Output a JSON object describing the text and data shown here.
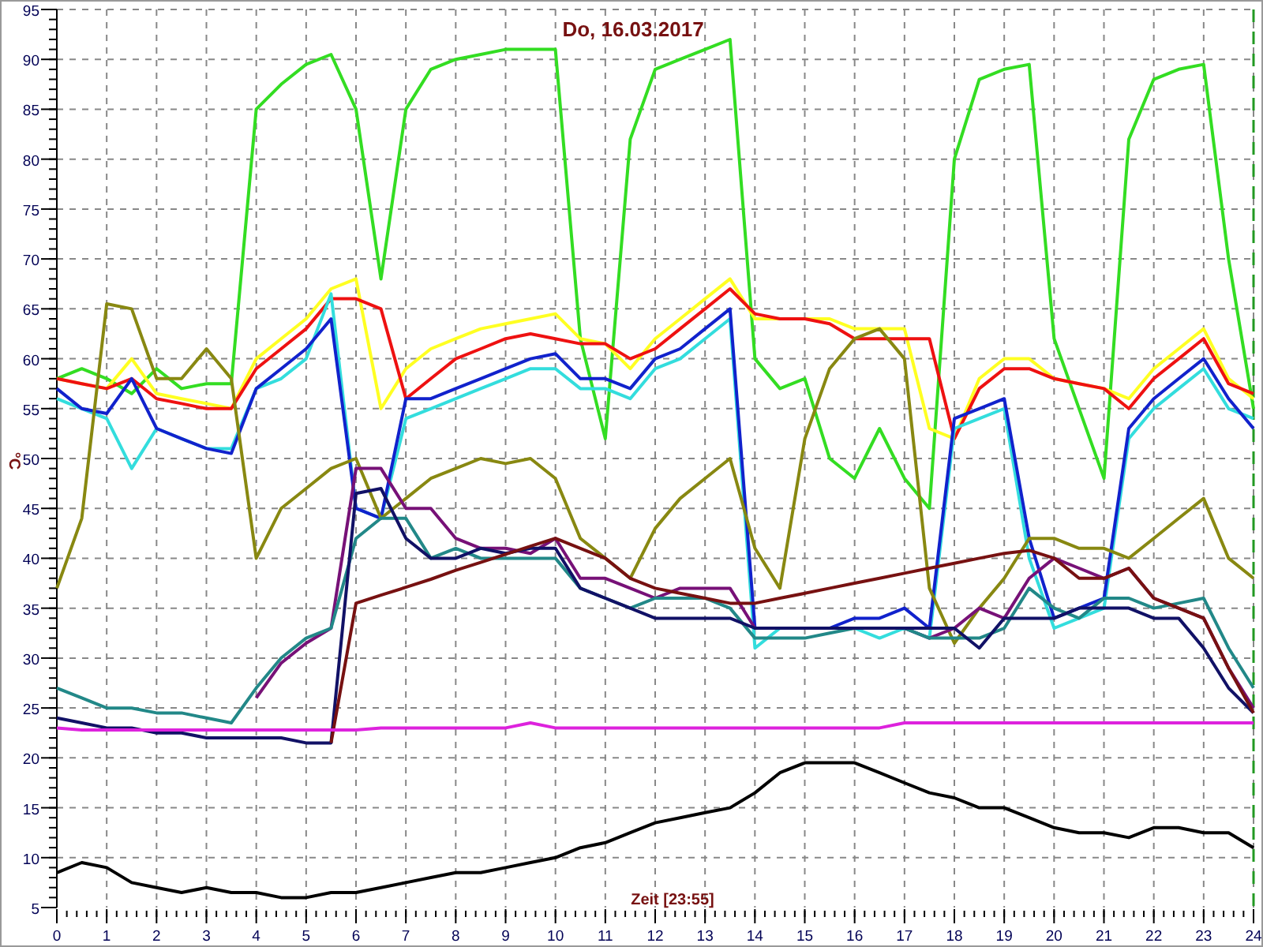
{
  "chart_data": {
    "type": "line",
    "title": "Do, 16.03.2017",
    "xlabel": "Zeit [23:55]",
    "ylabel": "°C",
    "x": [
      0,
      0.5,
      1,
      1.5,
      2,
      2.5,
      3,
      3.5,
      4,
      4.5,
      5,
      5.5,
      6,
      6.5,
      7,
      7.5,
      8,
      8.5,
      9,
      9.5,
      10,
      10.5,
      11,
      11.5,
      12,
      12.5,
      13,
      13.5,
      14,
      14.5,
      15,
      15.5,
      16,
      16.5,
      17,
      17.5,
      18,
      18.5,
      19,
      19.5,
      20,
      20.5,
      21,
      21.5,
      22,
      22.5,
      23,
      23.5,
      24
    ],
    "grid": true,
    "xlim": [
      0,
      24
    ],
    "ylim": [
      5,
      95
    ],
    "xticks": [
      0,
      1,
      2,
      3,
      4,
      5,
      6,
      7,
      8,
      9,
      10,
      11,
      12,
      13,
      14,
      15,
      16,
      17,
      18,
      19,
      20,
      21,
      22,
      23,
      24
    ],
    "yticks": [
      5,
      10,
      15,
      20,
      25,
      30,
      35,
      40,
      45,
      50,
      55,
      60,
      65,
      70,
      75,
      80,
      85,
      90,
      95
    ],
    "series": [
      {
        "color": "#33dd22",
        "values": [
          58,
          59,
          58,
          56.5,
          59,
          57,
          57.5,
          57.5,
          85,
          87.5,
          89.5,
          90.5,
          85,
          68,
          85,
          89,
          90,
          90.5,
          91,
          91,
          91,
          62,
          52,
          82,
          89,
          90,
          91,
          92,
          60,
          57,
          58,
          50,
          48,
          53,
          48,
          45,
          80,
          88,
          89,
          89.5,
          62,
          55,
          48,
          82,
          88,
          89,
          89.5,
          70,
          55
        ]
      },
      {
        "color": "#ffff22",
        "values": [
          58,
          57.5,
          57,
          60,
          56.5,
          56,
          55.5,
          55,
          60,
          62,
          64,
          67,
          68,
          55,
          59,
          61,
          62,
          63,
          63.5,
          64,
          64.5,
          62,
          61.5,
          59,
          62,
          64,
          66,
          68,
          64,
          64,
          64,
          64,
          63,
          63,
          63,
          53,
          52,
          58,
          60,
          60,
          58,
          57.5,
          57,
          56,
          59,
          61,
          63,
          58,
          56
        ]
      },
      {
        "color": "#ee1111",
        "values": [
          58,
          57.5,
          57,
          58,
          56,
          55.5,
          55,
          55,
          59,
          61,
          63,
          66,
          66,
          65,
          56,
          58,
          60,
          61,
          62,
          62.5,
          62,
          61.5,
          61.5,
          60,
          61,
          63,
          65,
          67,
          64.5,
          64,
          64,
          63.5,
          62,
          62,
          62,
          62,
          52,
          57,
          59,
          59,
          58,
          57.5,
          57,
          55,
          58,
          60,
          62,
          57.5,
          56.5
        ]
      },
      {
        "color": "#33dddd",
        "values": [
          56,
          55,
          54,
          49,
          53,
          52,
          51,
          51,
          57,
          58,
          60,
          66.5,
          45,
          44,
          54,
          55,
          56,
          57,
          58,
          59,
          59,
          57,
          57,
          56,
          59,
          60,
          62,
          64,
          31,
          33,
          33,
          33,
          33,
          32,
          33,
          32,
          53,
          54,
          55,
          40,
          33,
          34,
          35,
          52,
          55,
          57,
          59,
          55,
          54
        ]
      },
      {
        "color": "#1122cc",
        "values": [
          57,
          55,
          54.5,
          58,
          53,
          52,
          51,
          50.5,
          57,
          59,
          61,
          64,
          45,
          44,
          56,
          56,
          57,
          58,
          59,
          60,
          60.5,
          58,
          58,
          57,
          60,
          61,
          63,
          65,
          33,
          33,
          33,
          33,
          34,
          34,
          35,
          33,
          54,
          55,
          56,
          42,
          34,
          35,
          36,
          53,
          56,
          58,
          60,
          56,
          53
        ]
      },
      {
        "color": "#888811",
        "values": [
          37,
          44,
          65.5,
          65,
          58,
          58,
          61,
          58,
          40,
          45,
          47,
          49,
          50,
          44,
          46,
          48,
          49,
          50,
          49.5,
          50,
          48,
          42,
          40,
          38,
          43,
          46,
          48,
          50,
          41,
          37,
          52,
          59,
          62,
          63,
          60,
          37,
          31.5,
          35,
          38,
          42,
          42,
          41,
          41,
          40,
          42,
          44,
          46,
          40,
          38
        ]
      },
      {
        "color": "#771177",
        "values": [
          null,
          null,
          null,
          null,
          null,
          null,
          null,
          null,
          26,
          29.5,
          31.5,
          33,
          49,
          49,
          45,
          45,
          42,
          41,
          41,
          40.5,
          42,
          38,
          38,
          37,
          36,
          37,
          37,
          37,
          33,
          33,
          33,
          33,
          33,
          33,
          33,
          32,
          33,
          35,
          34,
          38,
          40,
          39,
          38,
          39,
          36,
          35,
          34,
          29,
          25
        ]
      },
      {
        "color": "#228888",
        "values": [
          27,
          26,
          25,
          25,
          24.5,
          24.5,
          24,
          23.5,
          27,
          30,
          32,
          33,
          42,
          44,
          44,
          40,
          41,
          40,
          40,
          40,
          40,
          37,
          36,
          35,
          36,
          36,
          36,
          35,
          32,
          32,
          32,
          32.5,
          33,
          33,
          33,
          32,
          32,
          32,
          33,
          37,
          35,
          34,
          36,
          36,
          35,
          35.5,
          36,
          31,
          27
        ]
      },
      {
        "color": "#111166",
        "values": [
          24,
          23.5,
          23,
          23,
          22.5,
          22.5,
          22,
          22,
          22,
          22,
          21.5,
          21.5,
          46.5,
          47,
          42,
          40,
          40,
          41,
          40.5,
          41,
          41,
          37,
          36,
          35,
          34,
          34,
          34,
          34,
          33,
          33,
          33,
          33,
          33,
          33,
          33,
          33,
          33,
          31,
          34,
          34,
          34,
          35,
          35,
          35,
          34,
          34,
          31,
          27,
          24.5
        ]
      },
      {
        "color": "#771111",
        "values": [
          null,
          null,
          null,
          null,
          null,
          null,
          null,
          null,
          null,
          null,
          null,
          21.5,
          35.5,
          36.3,
          37.1,
          37.9,
          38.8,
          39.6,
          40.4,
          41.2,
          42,
          41,
          40,
          38,
          37,
          36.5,
          36,
          35.5,
          35.5,
          36,
          36.5,
          37,
          37.5,
          38,
          38.5,
          39,
          39.5,
          40,
          40.5,
          40.8,
          40,
          38,
          38,
          39,
          36,
          35,
          34,
          29,
          24.5
        ]
      },
      {
        "color": "#dd22dd",
        "values": [
          23,
          22.8,
          22.8,
          22.8,
          22.8,
          22.8,
          22.8,
          22.8,
          22.8,
          22.8,
          22.8,
          22.8,
          22.8,
          23,
          23,
          23,
          23,
          23,
          23,
          23.5,
          23,
          23,
          23,
          23,
          23,
          23,
          23,
          23,
          23,
          23,
          23,
          23,
          23,
          23,
          23.5,
          23.5,
          23.5,
          23.5,
          23.5,
          23.5,
          23.5,
          23.5,
          23.5,
          23.5,
          23.5,
          23.5,
          23.5,
          23.5,
          23.5
        ]
      },
      {
        "color": "#000000",
        "values": [
          8.5,
          9.5,
          9,
          7.5,
          7,
          6.5,
          7,
          6.5,
          6.5,
          6,
          6,
          6.5,
          6.5,
          7,
          7.5,
          8,
          8.5,
          8.5,
          9,
          9.5,
          10,
          11,
          11.5,
          12.5,
          13.5,
          14,
          14.5,
          15,
          16.5,
          18.5,
          19.5,
          19.5,
          19.5,
          18.5,
          17.5,
          16.5,
          16,
          15,
          15,
          14,
          13,
          12.5,
          12.5,
          12,
          13,
          13,
          12.5,
          12.5,
          11
        ]
      }
    ]
  }
}
